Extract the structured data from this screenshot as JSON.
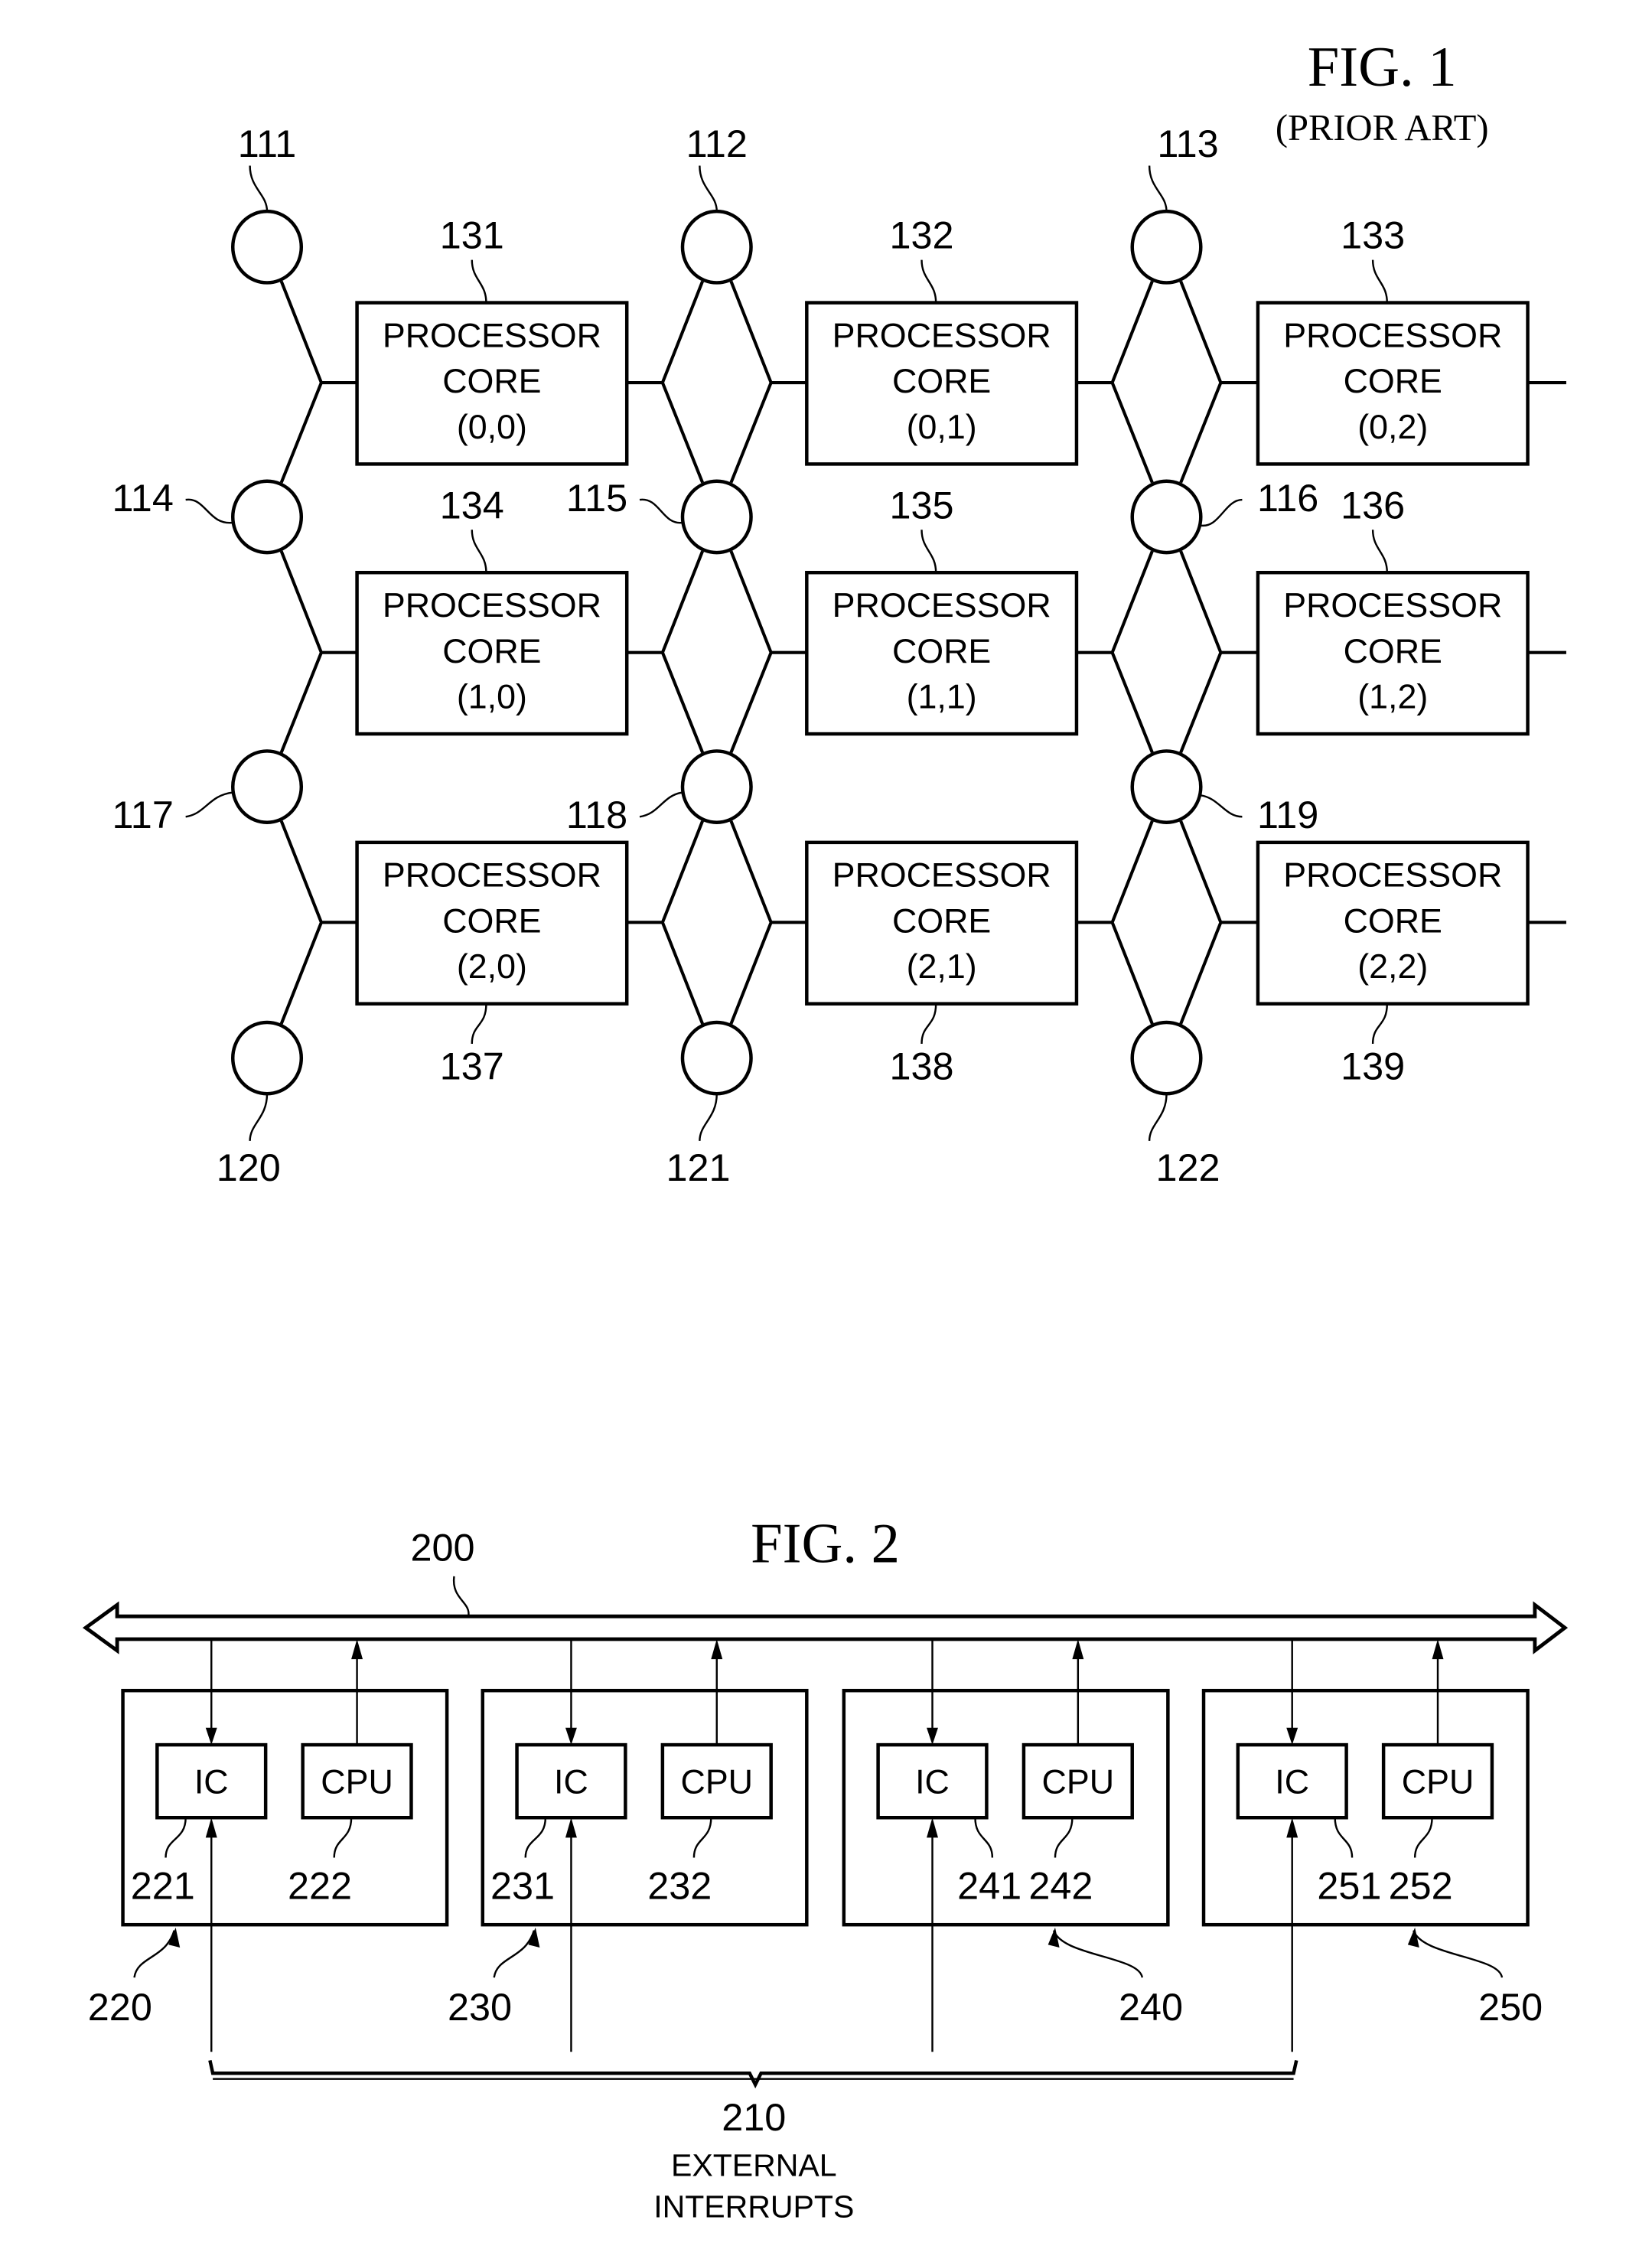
{
  "fig1": {
    "title": "FIG. 1",
    "subtitle": "(PRIOR ART)",
    "core_label_line1": "PROCESSOR",
    "core_label_line2": "CORE",
    "cores": [
      {
        "ref": "131",
        "coord": "(0,0)"
      },
      {
        "ref": "132",
        "coord": "(0,1)"
      },
      {
        "ref": "133",
        "coord": "(0,2)"
      },
      {
        "ref": "134",
        "coord": "(1,0)"
      },
      {
        "ref": "135",
        "coord": "(1,1)"
      },
      {
        "ref": "136",
        "coord": "(1,2)"
      },
      {
        "ref": "137",
        "coord": "(2,0)"
      },
      {
        "ref": "138",
        "coord": "(2,1)"
      },
      {
        "ref": "139",
        "coord": "(2,2)"
      }
    ],
    "nodes": [
      "111",
      "112",
      "113",
      "114",
      "115",
      "116",
      "117",
      "118",
      "119",
      "120",
      "121",
      "122"
    ]
  },
  "fig2": {
    "title": "FIG. 2",
    "bus_ref": "200",
    "interrupts_ref": "210",
    "interrupts_line1": "EXTERNAL",
    "interrupts_line2": "INTERRUPTS",
    "ic_label": "IC",
    "cpu_label": "CPU",
    "units": [
      {
        "ref": "220",
        "ic_ref": "221",
        "cpu_ref": "222"
      },
      {
        "ref": "230",
        "ic_ref": "231",
        "cpu_ref": "232"
      },
      {
        "ref": "240",
        "ic_ref": "241",
        "cpu_ref": "242"
      },
      {
        "ref": "250",
        "ic_ref": "251",
        "cpu_ref": "252"
      }
    ]
  }
}
